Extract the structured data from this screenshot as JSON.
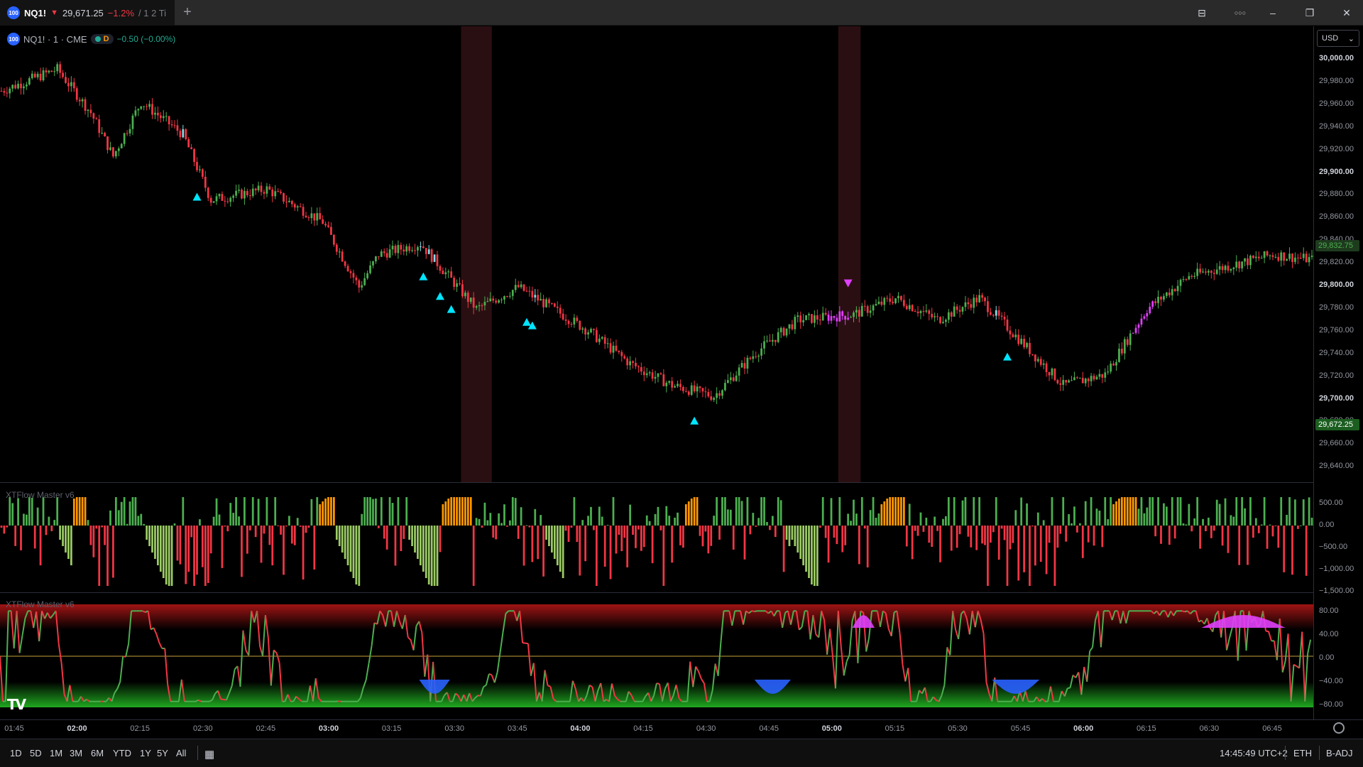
{
  "tab": {
    "logo": "100",
    "symbol": "NQ1!",
    "arrow": "▼",
    "price": "29,671.25",
    "change": "−1.2%",
    "rest": "/ 1 2 Ti"
  },
  "window": {
    "new_tab": "+",
    "minimize": "–",
    "restore": "❐",
    "close": "✕",
    "more": "○○○",
    "layout": "⊟"
  },
  "legend": {
    "logo": "100",
    "symbol": "NQ1! · 1 · CME",
    "session": "D",
    "change": "−0.50 (−0.00%)"
  },
  "currency": {
    "label": "USD",
    "arrow": "⌄"
  },
  "panes": {
    "osc1_title": "XTFlow Master v6",
    "osc2_title": "XTFlow Master v6"
  },
  "price_axis": [
    {
      "label": "30,000.00",
      "bold": true
    },
    {
      "label": "29,980.00",
      "bold": false
    },
    {
      "label": "29,960.00",
      "bold": false
    },
    {
      "label": "29,940.00",
      "bold": false
    },
    {
      "label": "29,920.00",
      "bold": false
    },
    {
      "label": "29,900.00",
      "bold": true
    },
    {
      "label": "29,880.00",
      "bold": false
    },
    {
      "label": "29,860.00",
      "bold": false
    },
    {
      "label": "29,840.00",
      "bold": false
    },
    {
      "label": "29,820.00",
      "bold": false
    },
    {
      "label": "29,800.00",
      "bold": true
    },
    {
      "label": "29,780.00",
      "bold": false
    },
    {
      "label": "29,760.00",
      "bold": false
    },
    {
      "label": "29,740.00",
      "bold": false
    },
    {
      "label": "29,720.00",
      "bold": false
    },
    {
      "label": "29,700.00",
      "bold": true
    },
    {
      "label": "29,680.00",
      "bold": false
    },
    {
      "label": "29,660.00",
      "bold": false
    },
    {
      "label": "29,640.00",
      "bold": false
    }
  ],
  "price_tags": {
    "close": "29,672.25",
    "prev": "29,832.75",
    "close_color": "#1b5e20",
    "prev_color": "#1e3b1e"
  },
  "osc1_axis": [
    "500.00",
    "0.00",
    "−500.00",
    "−1,000.00",
    "−1,500.00"
  ],
  "osc2_axis": [
    "80.00",
    "40.00",
    "0.00",
    "−40.00",
    "−80.00"
  ],
  "time_axis": [
    {
      "label": "01:45",
      "bold": false
    },
    {
      "label": "02:00",
      "bold": true
    },
    {
      "label": "02:15",
      "bold": false
    },
    {
      "label": "02:30",
      "bold": false
    },
    {
      "label": "02:45",
      "bold": false
    },
    {
      "label": "03:00",
      "bold": true
    },
    {
      "label": "03:15",
      "bold": false
    },
    {
      "label": "03:30",
      "bold": false
    },
    {
      "label": "03:45",
      "bold": false
    },
    {
      "label": "04:00",
      "bold": true
    },
    {
      "label": "04:15",
      "bold": false
    },
    {
      "label": "04:30",
      "bold": false
    },
    {
      "label": "04:45",
      "bold": false
    },
    {
      "label": "05:00",
      "bold": true
    },
    {
      "label": "05:15",
      "bold": false
    },
    {
      "label": "05:30",
      "bold": false
    },
    {
      "label": "05:45",
      "bold": false
    },
    {
      "label": "06:00",
      "bold": true
    },
    {
      "label": "06:15",
      "bold": false
    },
    {
      "label": "06:30",
      "bold": false
    },
    {
      "label": "06:45",
      "bold": false
    }
  ],
  "ranges": [
    "1D",
    "5D",
    "1M",
    "3M",
    "6M",
    "YTD",
    "1Y",
    "5Y",
    "All"
  ],
  "bottom": {
    "clock": "14:45:49 UTC+2",
    "session": "ETH",
    "adjust": "B-ADJ"
  },
  "tv_logo": "TV",
  "colors": {
    "up": "#4caf50",
    "down": "#f23645",
    "cyan": "#00e5ff",
    "magenta": "#e040fb",
    "orange": "#ff9800",
    "lightgreen": "#9ccc65",
    "session_band": "#2a0f12"
  },
  "chart_data": {
    "type": "candlestick",
    "ylim": [
      29640,
      30010
    ],
    "anchors": [
      [
        0,
        29980
      ],
      [
        20,
        30000
      ],
      [
        32,
        29960
      ],
      [
        40,
        29920
      ],
      [
        50,
        29970
      ],
      [
        65,
        29940
      ],
      [
        75,
        29880
      ],
      [
        95,
        29890
      ],
      [
        115,
        29860
      ],
      [
        128,
        29800
      ],
      [
        135,
        29830
      ],
      [
        150,
        29840
      ],
      [
        170,
        29780
      ],
      [
        185,
        29800
      ],
      [
        210,
        29760
      ],
      [
        225,
        29730
      ],
      [
        240,
        29710
      ],
      [
        255,
        29700
      ],
      [
        270,
        29740
      ],
      [
        285,
        29770
      ],
      [
        305,
        29775
      ],
      [
        320,
        29790
      ],
      [
        335,
        29770
      ],
      [
        350,
        29790
      ],
      [
        365,
        29750
      ],
      [
        380,
        29710
      ],
      [
        395,
        29720
      ],
      [
        410,
        29780
      ],
      [
        425,
        29810
      ],
      [
        440,
        29820
      ],
      [
        455,
        29830
      ],
      [
        470,
        29825
      ]
    ],
    "buy_signals": [
      70,
      151,
      157,
      161,
      188,
      190,
      248,
      360
    ],
    "sell_signals": [
      303
    ],
    "session_bands": [
      [
        165,
        176
      ],
      [
        300,
        308
      ]
    ]
  }
}
